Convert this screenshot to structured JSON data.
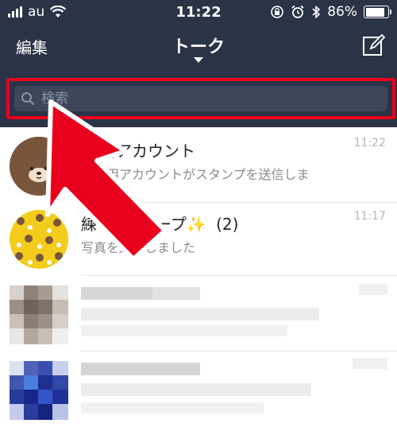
{
  "status_bar": {
    "carrier": "au",
    "time": "11:22",
    "battery_text": "86%",
    "battery_level": 0.86
  },
  "header": {
    "edit_label": "編集",
    "title": "トーク"
  },
  "search": {
    "placeholder": "検索"
  },
  "chats": [
    {
      "name": "用アカウント",
      "preview": "用アカウントがスタンプを送信しま",
      "time": "11:22"
    },
    {
      "name": "練",
      "name_suffix": "グループ✨",
      "member_count": "(2)",
      "preview": "写真を送信しました",
      "time": "11:17"
    }
  ],
  "colors": {
    "header_bg": "#2b3347",
    "highlight": "#e8001c",
    "arrow": "#e8001c"
  }
}
